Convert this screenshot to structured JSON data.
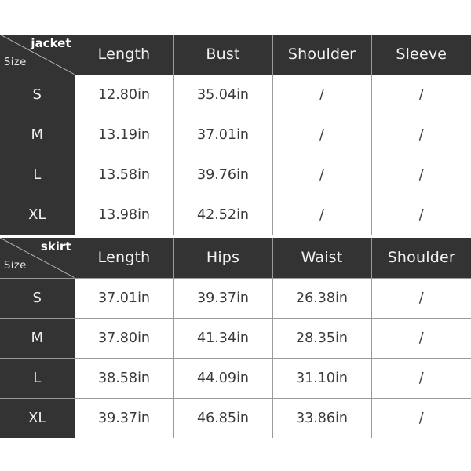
{
  "page": {
    "background_color": "#ffffff",
    "header_color": "#333333",
    "header_text_color": "#f2f2f2",
    "cell_text_color": "#3a3a3a",
    "grid_line_color": "#9a9a9a"
  },
  "tables": [
    {
      "id": "jacket",
      "corner": {
        "category_label": "jacket",
        "size_label": "Size"
      },
      "columns": [
        "Length",
        "Bust",
        "Shoulder",
        "Sleeve"
      ],
      "rows": [
        {
          "size": "S",
          "values": [
            "12.80in",
            "35.04in",
            "/",
            "/"
          ]
        },
        {
          "size": "M",
          "values": [
            "13.19in",
            "37.01in",
            "/",
            "/"
          ]
        },
        {
          "size": "L",
          "values": [
            "13.58in",
            "39.76in",
            "/",
            "/"
          ]
        },
        {
          "size": "XL",
          "values": [
            "13.98in",
            "42.52in",
            "/",
            "/"
          ]
        }
      ]
    },
    {
      "id": "skirt",
      "corner": {
        "category_label": "skirt",
        "size_label": "Size"
      },
      "columns": [
        "Length",
        "Hips",
        "Waist",
        "Shoulder"
      ],
      "rows": [
        {
          "size": "S",
          "values": [
            "37.01in",
            "39.37in",
            "26.38in",
            "/"
          ]
        },
        {
          "size": "M",
          "values": [
            "37.80in",
            "41.34in",
            "28.35in",
            "/"
          ]
        },
        {
          "size": "L",
          "values": [
            "38.58in",
            "44.09in",
            "31.10in",
            "/"
          ]
        },
        {
          "size": "XL",
          "values": [
            "39.37in",
            "46.85in",
            "33.86in",
            "/"
          ]
        }
      ]
    }
  ]
}
